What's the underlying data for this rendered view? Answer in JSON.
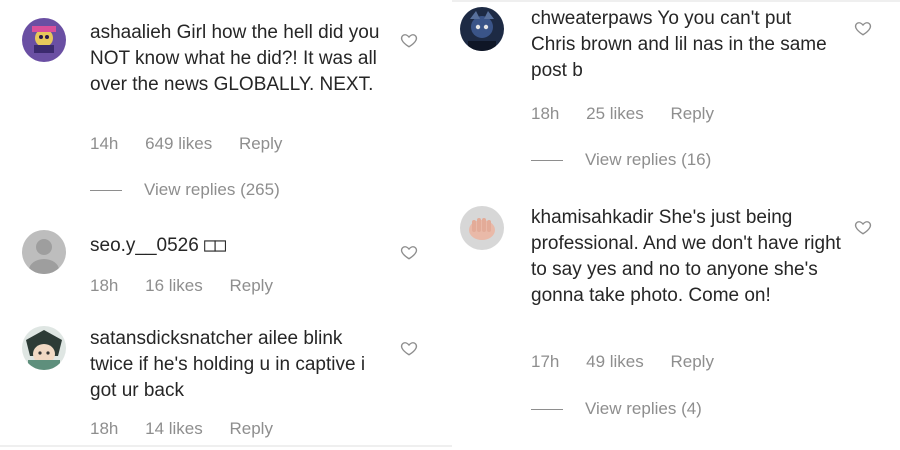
{
  "left_column": [
    {
      "username": "ashaalieh",
      "text": "Girl how the hell did you NOT know what he did?! It was all over the news GLOBALLY. NEXT.",
      "time": "14h",
      "likes": "649 likes",
      "reply": "Reply",
      "view_replies": "View replies (265)",
      "avatar_icon": "purple-character-avatar"
    },
    {
      "username": "seo.y__0526",
      "text": "□□",
      "time": "18h",
      "likes": "16 likes",
      "reply": "Reply",
      "avatar_icon": "default-gray-avatar"
    },
    {
      "username": "satansdicksnatcher",
      "text": "ailee blink twice if he's holding u in captive i got ur back",
      "time": "18h",
      "likes": "14 likes",
      "reply": "Reply",
      "avatar_icon": "anime-character-avatar"
    }
  ],
  "right_column": [
    {
      "username": "chweaterpaws",
      "text": "Yo you can't put Chris brown and lil nas in the same post b",
      "time": "18h",
      "likes": "25 likes",
      "reply": "Reply",
      "view_replies": "View replies (16)",
      "avatar_icon": "dark-blue-character-avatar"
    },
    {
      "username": "khamisahkadir",
      "text": "She's just being professional. And we don't have right to say yes and no to anyone she's gonna take photo. Come on!",
      "time": "17h",
      "likes": "49 likes",
      "reply": "Reply",
      "view_replies": "View replies (4)",
      "avatar_icon": "hand-photo-avatar"
    }
  ],
  "colors": {
    "text": "#262626",
    "meta": "#8e8e8e",
    "divider": "#efefef"
  }
}
